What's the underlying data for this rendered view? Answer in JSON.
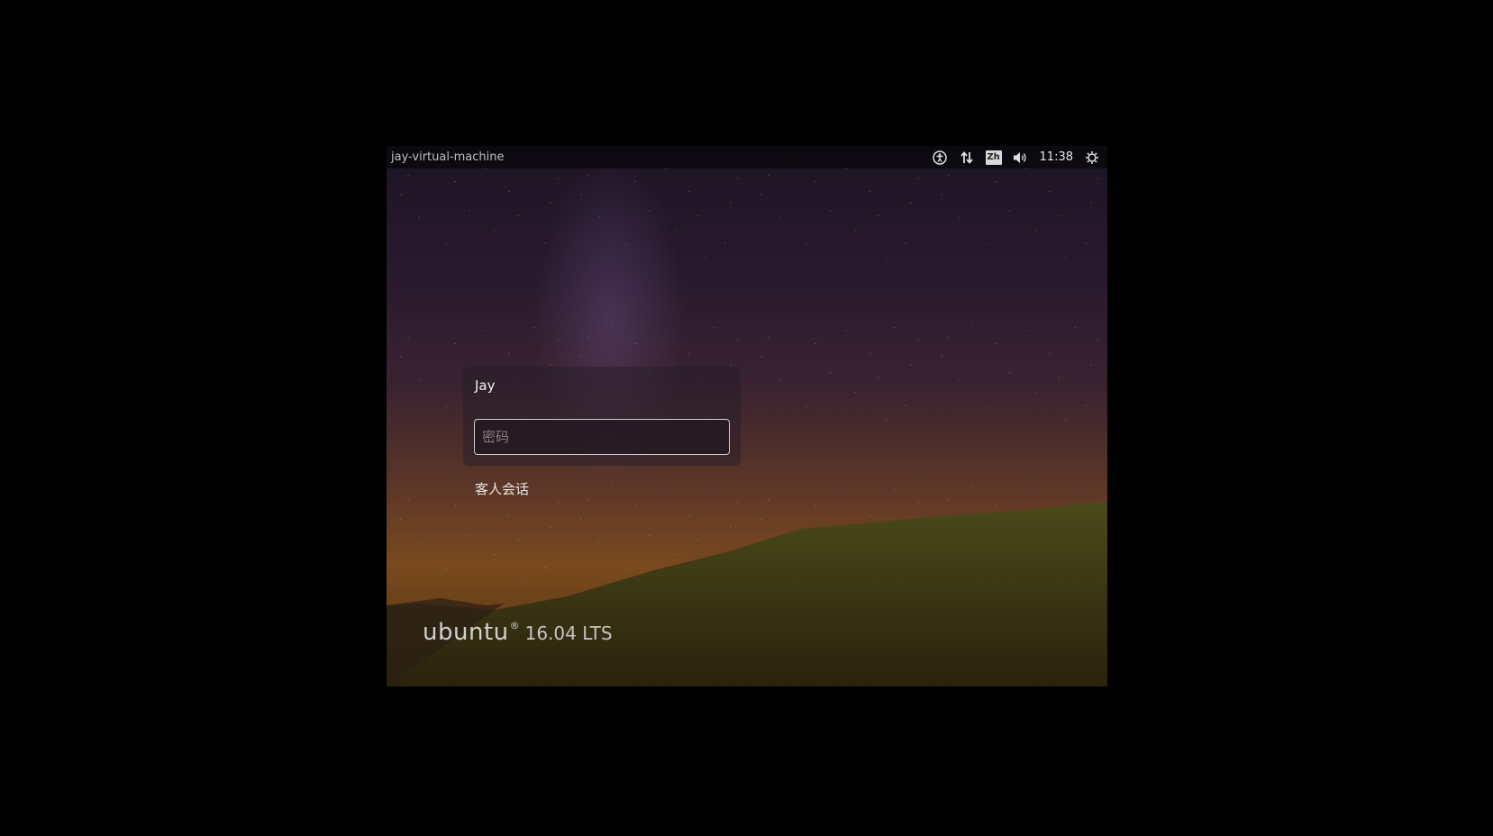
{
  "top_bar": {
    "hostname": "jay-virtual-machine",
    "icons": [
      "accessibility-icon",
      "network-icon",
      "keyboard-layout-icon",
      "volume-icon",
      "power-icon"
    ],
    "keyboard_layout": "Zh",
    "clock": "11:38"
  },
  "login": {
    "user": "Jay",
    "password_placeholder": "密码",
    "guest_session": "客人会话"
  },
  "branding": {
    "name": "ubuntu",
    "registered": "®",
    "version": "16.04 LTS"
  }
}
